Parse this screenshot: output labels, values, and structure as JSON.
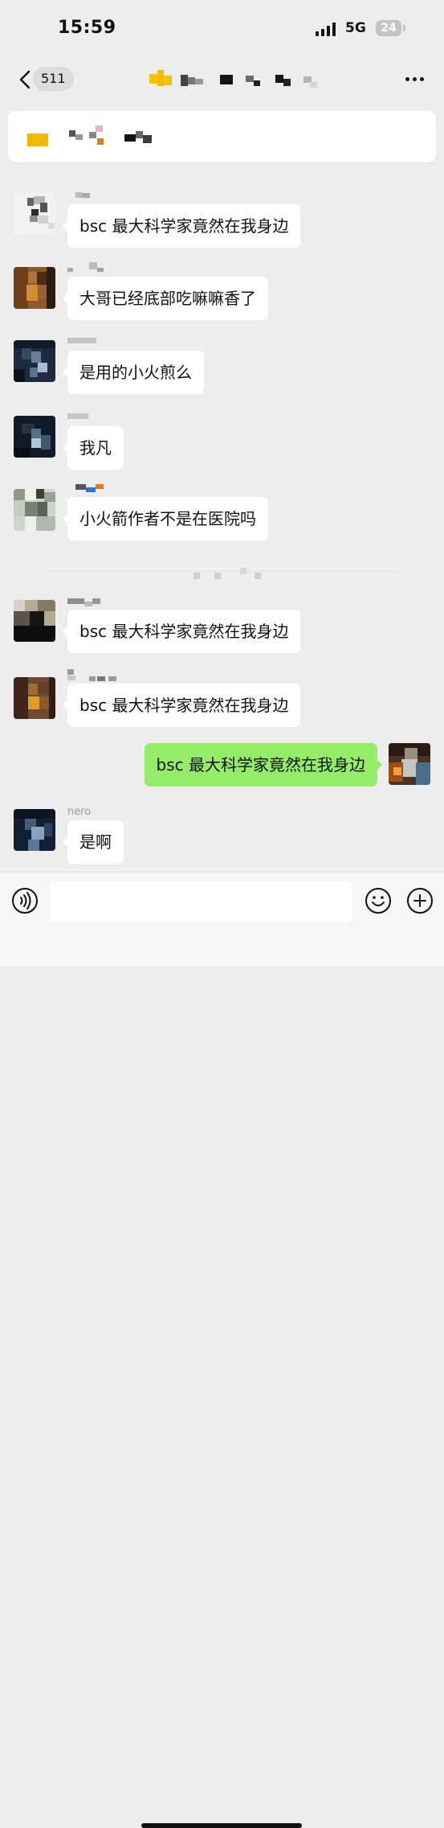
{
  "status_bar": {
    "time": "15:59",
    "network": "5G",
    "battery": "24"
  },
  "nav": {
    "unread_count": "511"
  },
  "messages": [
    {
      "text": "bsc 最大科学家竟然在我身边"
    },
    {
      "text": "大哥已经底部吃嘛嘛香了"
    },
    {
      "text": "是用的小火煎么"
    },
    {
      "text": "我凡"
    },
    {
      "text": "小火箭作者不是在医院吗"
    },
    {
      "text": "bsc 最大科学家竟然在我身边"
    },
    {
      "text": "bsc 最大科学家竟然在我身边"
    },
    {
      "text": "bsc 最大科学家竟然在我身边"
    },
    {
      "text": "是啊"
    }
  ],
  "sender_names": {
    "last": "nero"
  },
  "colors": {
    "background": "#ededed",
    "incoming_bubble": "#ffffff",
    "outgoing_bubble": "#95ec69",
    "badge": "#dcdcdc"
  },
  "icons": {
    "back": "chevron-left-icon",
    "more": "more-icon",
    "voice": "voice-icon",
    "emoji": "emoji-icon",
    "plus": "plus-icon"
  }
}
